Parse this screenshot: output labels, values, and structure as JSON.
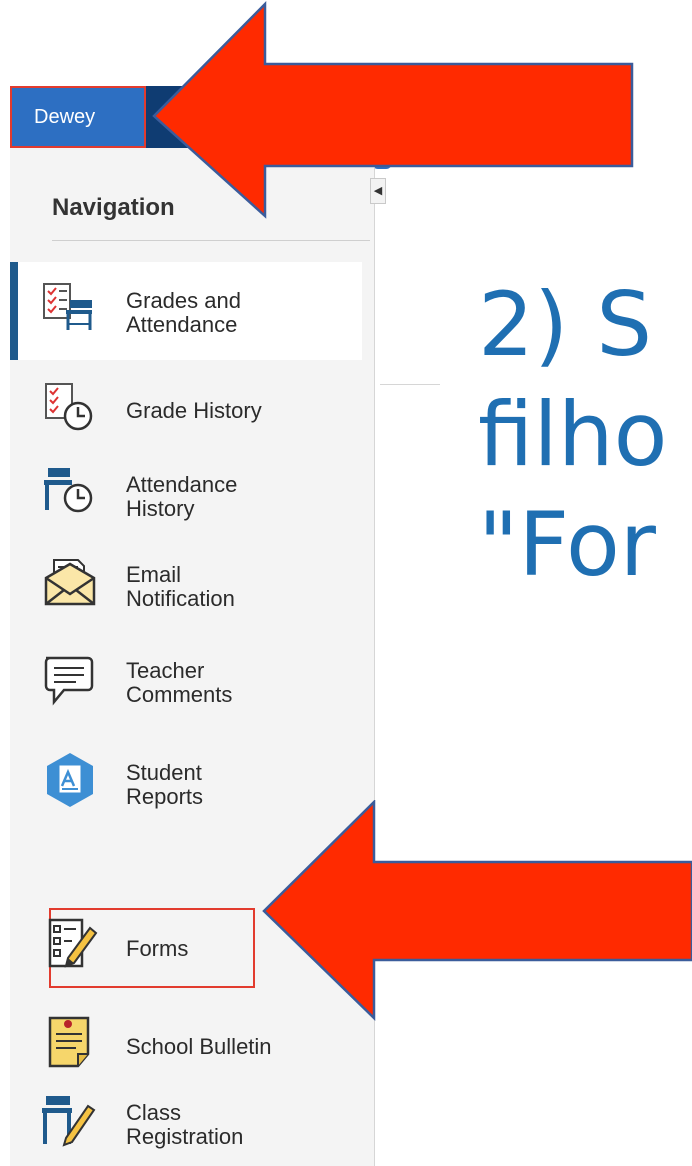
{
  "header": {
    "user_name": "Dewey"
  },
  "sidebar": {
    "heading": "Navigation",
    "items": [
      {
        "label": "Grades and\nAttendance",
        "icon": "grades-attendance-icon",
        "active": true
      },
      {
        "label": "Grade History",
        "icon": "grade-history-icon"
      },
      {
        "label": "Attendance\nHistory",
        "icon": "attendance-history-icon"
      },
      {
        "label": "Email\nNotification",
        "icon": "email-notification-icon"
      },
      {
        "label": "Teacher\nComments",
        "icon": "teacher-comments-icon"
      },
      {
        "label": "Student\nReports",
        "icon": "student-reports-icon"
      },
      {
        "label": "Forms",
        "icon": "forms-icon",
        "highlighted": true
      },
      {
        "label": "School Bulletin",
        "icon": "school-bulletin-icon"
      },
      {
        "label": "Class\nRegistration",
        "icon": "class-registration-icon"
      }
    ]
  },
  "instruction": {
    "line1": "2) S",
    "line2": "filho",
    "line3": "\"For"
  },
  "colors": {
    "topbar": "#0f3c72",
    "user_tab": "#2d6fc2",
    "highlight": "#e23b2e",
    "arrow": "#ff2a00",
    "instruction_text": "#1f6fb2",
    "active_bar": "#1f5a8c"
  }
}
